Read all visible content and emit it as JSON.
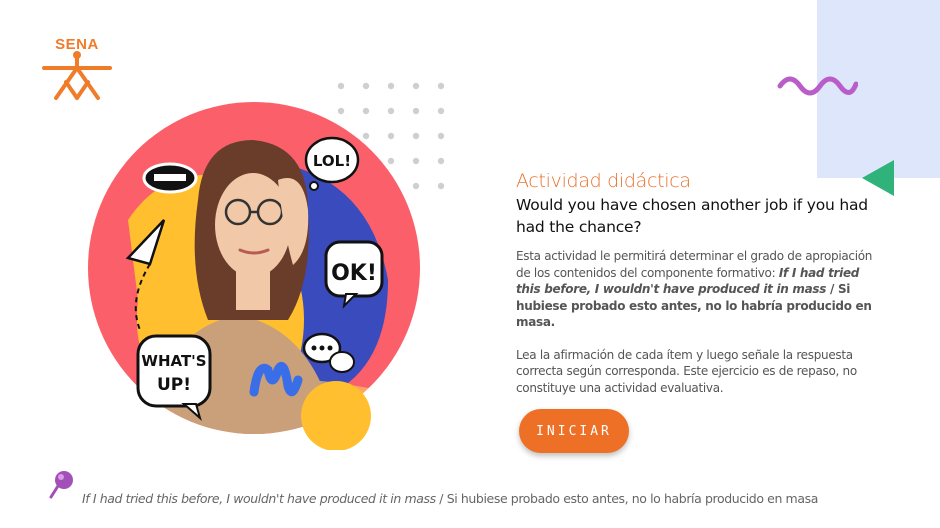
{
  "logo": {
    "text": "SENA",
    "color": "#f07c2a"
  },
  "hero": {
    "stickers": [
      "LOL!",
      "OK!",
      "WHAT'S",
      "UP!"
    ],
    "colors": {
      "circle": "#fb5f6a",
      "yellow": "#ffbf2e",
      "blue": "#3a4bbd"
    }
  },
  "activity": {
    "title": "Actividad didáctica",
    "question": "Would you have chosen another job if you had had the chance?",
    "description_intro": "Esta actividad le permitirá determinar el grado de apropiación de los contenidos del componente formativo:",
    "phrase_en": "If I had tried this before, I wouldn't have produced it in mass",
    "phrase_es": "Si hubiese probado esto antes, no lo habría producido en masa.",
    "instructions": "Lea la afirmación de cada ítem y luego señale la respuesta correcta según corresponda.  Este ejercicio es de repaso, no constituye una actividad evaluativa."
  },
  "start_button": {
    "label": "INICIAR",
    "color": "#ee6f26"
  },
  "footer": {
    "phrase_en": "If I had tried this before, I wouldn't have produced it in mass",
    "phrase_es": "Si hubiese probado esto antes, no lo habría producido en masa"
  }
}
